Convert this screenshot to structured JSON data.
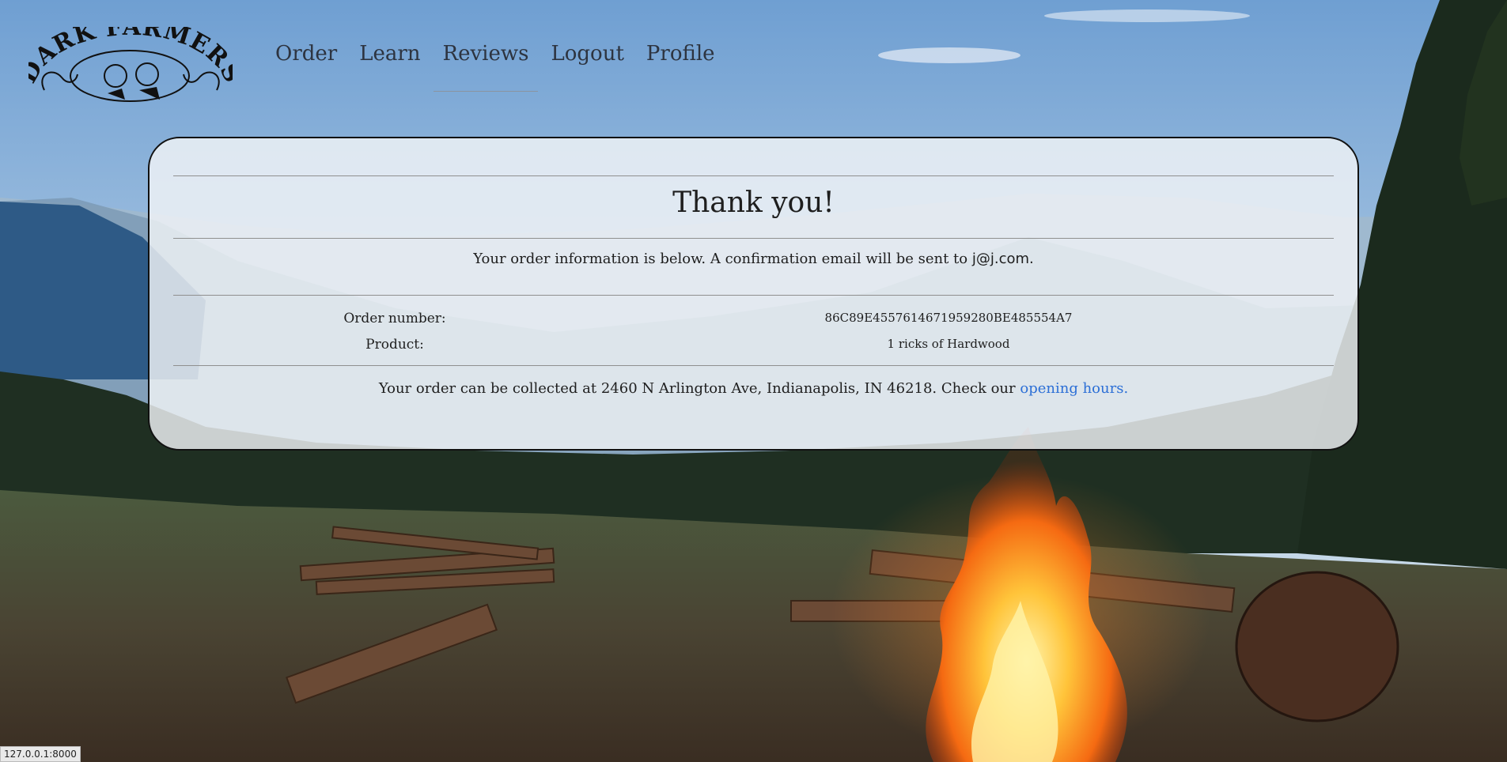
{
  "brand": {
    "logo_text": "DARK FARMERS"
  },
  "nav": [
    {
      "label": "Order",
      "active": false
    },
    {
      "label": "Learn",
      "active": false
    },
    {
      "label": "Reviews",
      "active": true
    },
    {
      "label": "Logout",
      "active": false
    },
    {
      "label": "Profile",
      "active": false
    }
  ],
  "confirmation": {
    "title": "Thank you!",
    "info_prefix": "Your order information is below. A confirmation email will be sent to",
    "email": "j@j.com.",
    "order_number_label": "Order number:",
    "order_number": "86C89E4557614671959280BE485554A7",
    "product_label": "Product:",
    "product": "1 ricks of Hardwood",
    "collect_prefix": "Your order can be collected at 2460 N Arlington Ave, Indianapolis, IN 46218. Check our",
    "hours_link": "opening hours."
  },
  "status_bar": {
    "url": "127.0.0.1:8000"
  },
  "colors": {
    "link": "#2c6fd6",
    "card_border": "#111111",
    "nav_text": "#2d3440"
  }
}
